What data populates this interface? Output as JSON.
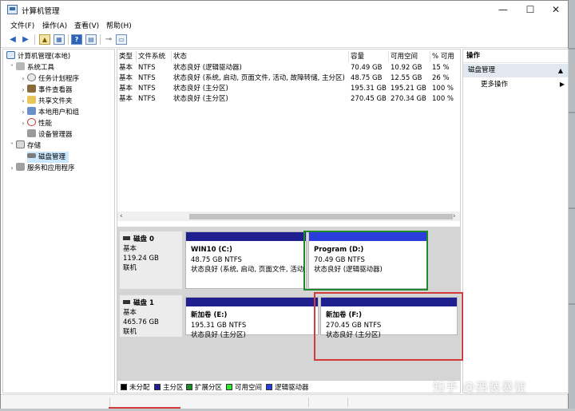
{
  "window": {
    "title": "计算机管理",
    "controls": {
      "minimize": "—",
      "maximize": "☐",
      "close": "✕"
    }
  },
  "menu": [
    "文件(F)",
    "操作(A)",
    "查看(V)",
    "帮助(H)"
  ],
  "toolbar": {
    "icons": [
      "back-arrow-icon",
      "forward-arrow-icon",
      "up-folder-icon",
      "show-hide-tree-icon",
      "help-icon",
      "properties-icon",
      "export-icon",
      "view-icon"
    ]
  },
  "tree": {
    "root": "计算机管理(本地)",
    "items": [
      {
        "label": "系统工具",
        "icon": "tools-icon",
        "expanded": true
      },
      {
        "label": "任务计划程序",
        "icon": "clock-icon"
      },
      {
        "label": "事件查看器",
        "icon": "event-viewer-icon"
      },
      {
        "label": "共享文件夹",
        "icon": "shared-folder-icon"
      },
      {
        "label": "本地用户和组",
        "icon": "users-icon"
      },
      {
        "label": "性能",
        "icon": "performance-icon"
      },
      {
        "label": "设备管理器",
        "icon": "device-manager-icon"
      },
      {
        "label": "存储",
        "icon": "storage-icon",
        "expanded": true
      },
      {
        "label": "磁盘管理",
        "icon": "disk-management-icon",
        "selected": true
      },
      {
        "label": "服务和应用程序",
        "icon": "services-icon"
      }
    ]
  },
  "volumes": {
    "headers": [
      "类型",
      "文件系统",
      "状态",
      "容量",
      "可用空间",
      "% 可用"
    ],
    "rows": [
      [
        "基本",
        "NTFS",
        "状态良好 (逻辑驱动器)",
        "70.49 GB",
        "10.92 GB",
        "15 %"
      ],
      [
        "基本",
        "NTFS",
        "状态良好 (系统, 启动, 页面文件, 活动, 故障转储, 主分区)",
        "48.75 GB",
        "12.55 GB",
        "26 %"
      ],
      [
        "基本",
        "NTFS",
        "状态良好 (主分区)",
        "195.31 GB",
        "195.21 GB",
        "100 %"
      ],
      [
        "基本",
        "NTFS",
        "状态良好 (主分区)",
        "270.45 GB",
        "270.34 GB",
        "100 %"
      ]
    ]
  },
  "disks": [
    {
      "name": "磁盘 0",
      "type": "基本",
      "size": "119.24 GB",
      "state": "联机",
      "partitions": [
        {
          "name": "WIN10  (C:)",
          "size": "48.75 GB NTFS",
          "status": "状态良好 (系统, 启动, 页面文件, 活动"
        },
        {
          "name": "Program  (D:)",
          "size": "70.49 GB NTFS",
          "status": "状态良好 (逻辑驱动器)"
        }
      ]
    },
    {
      "name": "磁盘 1",
      "type": "基本",
      "size": "465.76 GB",
      "state": "联机",
      "partitions": [
        {
          "name": "新加卷  (E:)",
          "size": "195.31 GB NTFS",
          "status": "状态良好 (主分区)"
        },
        {
          "name": "新加卷  (F:)",
          "size": "270.45 GB NTFS",
          "status": "状态良好 (主分区)"
        }
      ]
    }
  ],
  "legend": [
    {
      "label": "未分配",
      "color": "#000000"
    },
    {
      "label": "主分区",
      "color": "#1f1f8f"
    },
    {
      "label": "扩展分区",
      "color": "#1e8a2b"
    },
    {
      "label": "可用空间",
      "color": "#33e633"
    },
    {
      "label": "逻辑驱动器",
      "color": "#2a3cd9"
    }
  ],
  "actions": {
    "header": "操作",
    "section": "磁盘管理",
    "more": "更多操作"
  },
  "watermark": "知乎 @西装暴徒",
  "colors": {
    "primary_partition": "#1f1f8f",
    "logical_drive": "#2a3cd9",
    "highlight_green": "#1e8a2b",
    "highlight_red": "#d23b3b"
  }
}
